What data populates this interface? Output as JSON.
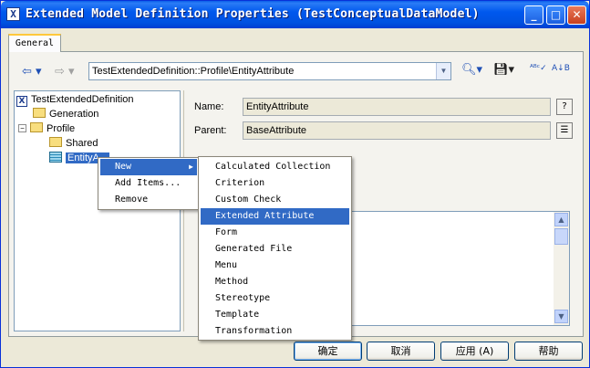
{
  "window": {
    "title": "Extended Model Definition Properties (TestConceptualDataModel)",
    "icon_letter": "X",
    "controls": {
      "minimize": "_",
      "maximize": "□",
      "close": "✕"
    }
  },
  "tabs": [
    {
      "label": "General"
    }
  ],
  "toolbar": {
    "path_value": "TestExtendedDefinition::Profile\\EntityAttribute",
    "icons": [
      "back-arrow-icon",
      "forward-arrow-icon",
      "find-icon",
      "save-icon",
      "spell-check-icon",
      "sort-icon"
    ]
  },
  "tree": {
    "root": "TestExtendedDefinition",
    "items": [
      {
        "label": "Generation"
      },
      {
        "label": "Profile"
      },
      {
        "label": "Shared"
      },
      {
        "label": "EntityA..."
      }
    ],
    "expand_symbol": "−"
  },
  "form": {
    "name_label": "Name:",
    "name_value": "EntityAttribute",
    "parent_label": "Parent:",
    "parent_value": "BaseAttribute",
    "help_glyph": "?",
    "props_glyph": "☰"
  },
  "context_menu": {
    "items": [
      {
        "label": "New",
        "has_submenu": true
      },
      {
        "label": "Add Items..."
      },
      {
        "label": "Remove"
      }
    ],
    "submenu_arrow": "▶"
  },
  "submenu": {
    "items": [
      "Calculated Collection",
      "Criterion",
      "Custom Check",
      "Extended Attribute",
      "Form",
      "Generated File",
      "Menu",
      "Method",
      "Stereotype",
      "Template",
      "Transformation"
    ],
    "highlighted": "Extended Attribute"
  },
  "buttons": {
    "ok": "确定",
    "cancel": "取消",
    "apply": "应用 (A)",
    "help": "帮助"
  },
  "colors": {
    "titlebar": "#0058EE",
    "selection": "#316AC5",
    "dialog_bg": "#ECE9D8"
  }
}
